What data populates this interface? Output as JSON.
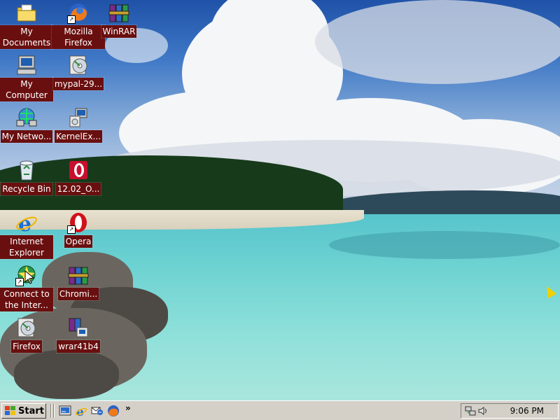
{
  "desktop": {
    "icons": [
      {
        "id": "my-documents",
        "label": "My Documents",
        "icon": "folder-documents-icon",
        "shortcut": false
      },
      {
        "id": "mozilla-firefox",
        "label": "Mozilla Firefox",
        "icon": "firefox-icon",
        "shortcut": true
      },
      {
        "id": "winrar",
        "label": "WinRAR",
        "icon": "winrar-books-icon",
        "shortcut": false
      },
      {
        "id": "my-computer",
        "label": "My Computer",
        "icon": "computer-icon",
        "shortcut": false
      },
      {
        "id": "mypal",
        "label": "mypal-29...",
        "icon": "installer-cd-icon",
        "shortcut": false
      },
      {
        "id": "my-network",
        "label": "My Netwo...",
        "icon": "network-places-icon",
        "shortcut": false
      },
      {
        "id": "kernelex",
        "label": "KernelEx...",
        "icon": "installer-pc-icon",
        "shortcut": false
      },
      {
        "id": "recycle-bin",
        "label": "Recycle Bin",
        "icon": "recycle-bin-icon",
        "shortcut": false
      },
      {
        "id": "opera-installer",
        "label": "12.02_O...",
        "icon": "opera-installer-icon",
        "shortcut": false
      },
      {
        "id": "internet-explorer",
        "label": "Internet Explorer",
        "icon": "internet-explorer-icon",
        "shortcut": false
      },
      {
        "id": "opera",
        "label": "Opera",
        "icon": "opera-icon",
        "shortcut": true
      },
      {
        "id": "connect-internet",
        "label": "Connect to the Inter...",
        "icon": "connect-internet-icon",
        "shortcut": true
      },
      {
        "id": "chromium",
        "label": "Chromi...",
        "icon": "winrar-books-icon",
        "shortcut": false
      },
      {
        "id": "firefox-installer",
        "label": "Firefox",
        "icon": "installer-cd-icon",
        "shortcut": false
      },
      {
        "id": "wrar41b4",
        "label": "wrar41b4",
        "icon": "winrar-installer-icon",
        "shortcut": false
      }
    ]
  },
  "taskbar": {
    "start_label": "Start",
    "quick_launch": [
      {
        "name": "show-desktop-icon"
      },
      {
        "name": "internet-explorer-icon"
      },
      {
        "name": "outlook-express-icon"
      },
      {
        "name": "firefox-icon"
      }
    ],
    "overflow_label": "»",
    "tray": {
      "icons": [
        "network-icon",
        "volume-icon"
      ],
      "clock": "9:06 PM"
    }
  },
  "colors": {
    "label_bg": "#6a0f0f",
    "taskbar": "#d4d0c8"
  }
}
